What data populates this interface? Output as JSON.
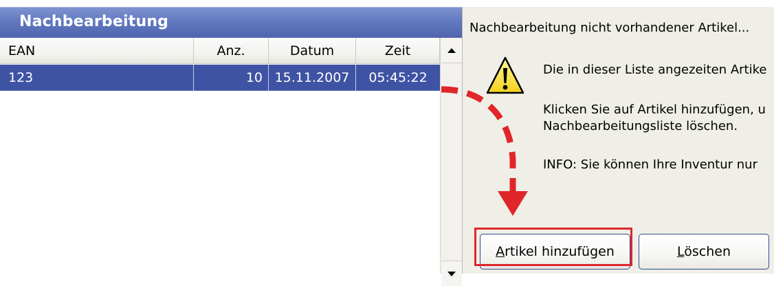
{
  "list_panel": {
    "title": "Nachbearbeitung",
    "columns": [
      "EAN",
      "Anz.",
      "Datum",
      "Zeit"
    ],
    "rows": [
      {
        "ean": "123",
        "anz": "10",
        "datum": "15.11.2007",
        "zeit": "05:45:22"
      }
    ]
  },
  "dialog": {
    "title": "Nachbearbeitung nicht vorhandener Artikel...",
    "icon": "warning-icon",
    "message_1": "Die in dieser Liste angezeiten Artike",
    "message_2_line_1": "Klicken Sie auf Artikel hinzufügen, u",
    "message_2_line_2": "Nachbearbeitungsliste löschen.",
    "message_3": "INFO: Sie können Ihre Inventur nur",
    "buttons": {
      "add_mnemonic": "A",
      "add_rest": "rtikel hinzufügen",
      "delete_mnemonic": "L",
      "delete_rest": "öschen"
    }
  },
  "annotation": {
    "color": "#e0262b"
  }
}
